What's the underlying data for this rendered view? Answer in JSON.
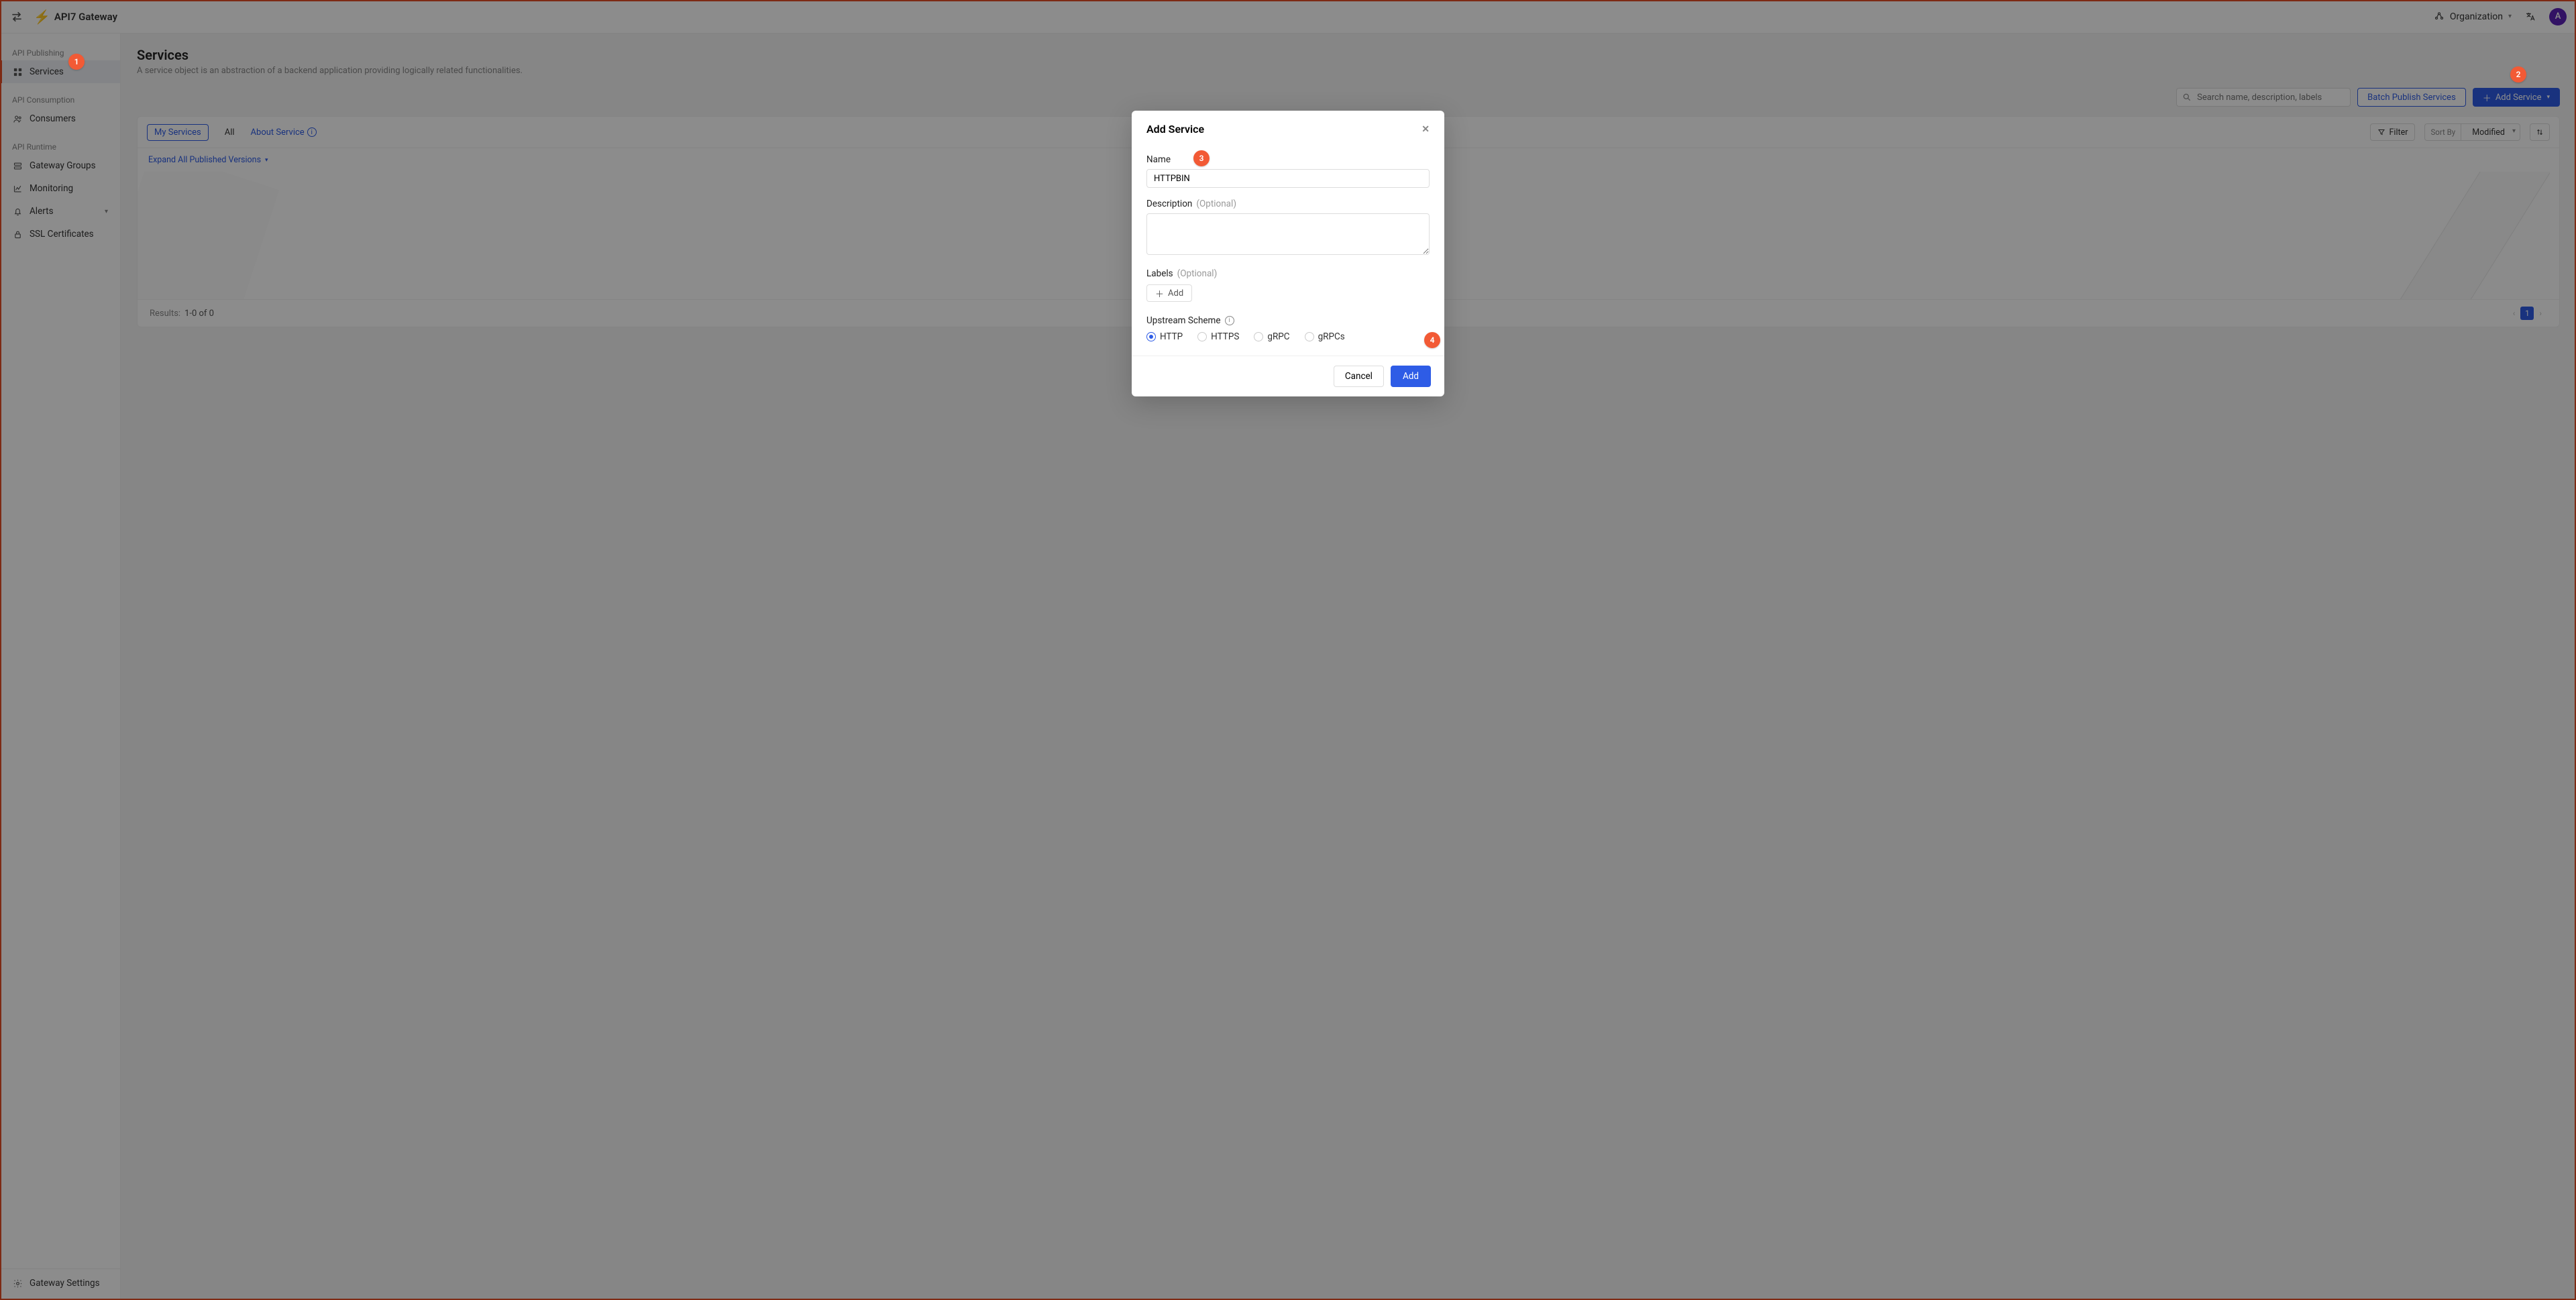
{
  "header": {
    "brand": "API7 Gateway",
    "org_label": "Organization",
    "avatar_letter": "A"
  },
  "sidebar": {
    "sections": {
      "publishing": "API Publishing",
      "consumption": "API Consumption",
      "runtime": "API Runtime"
    },
    "items": {
      "services": "Services",
      "consumers": "Consumers",
      "gateway_groups": "Gateway Groups",
      "monitoring": "Monitoring",
      "alerts": "Alerts",
      "ssl": "SSL Certificates",
      "settings": "Gateway Settings"
    }
  },
  "page": {
    "title": "Services",
    "subtitle": "A service object is an abstraction of a backend application providing logically related functionalities.",
    "search_placeholder": "Search name, description, labels",
    "batch_publish": "Batch Publish Services",
    "add_service": "Add Service",
    "tabs": {
      "mine": "My Services",
      "all": "All",
      "about": "About Service"
    },
    "filter": "Filter",
    "sort_by": "Sort By",
    "sort_value": "Modified",
    "expand": "Expand All Published Versions",
    "results_label": "Results:",
    "results_value": "1-0 of 0",
    "page_number": "1"
  },
  "modal": {
    "title": "Add Service",
    "name_label": "Name",
    "name_value": "HTTPBIN",
    "description_label": "Description",
    "labels_label": "Labels",
    "optional": "(Optional)",
    "add_btn": "Add",
    "scheme_label": "Upstream Scheme",
    "schemes": {
      "http": "HTTP",
      "https": "HTTPS",
      "grpc": "gRPC",
      "grpcs": "gRPCs"
    },
    "cancel": "Cancel",
    "submit": "Add"
  },
  "annotations": {
    "b1": "1",
    "b2": "2",
    "b3": "3",
    "b4": "4"
  }
}
